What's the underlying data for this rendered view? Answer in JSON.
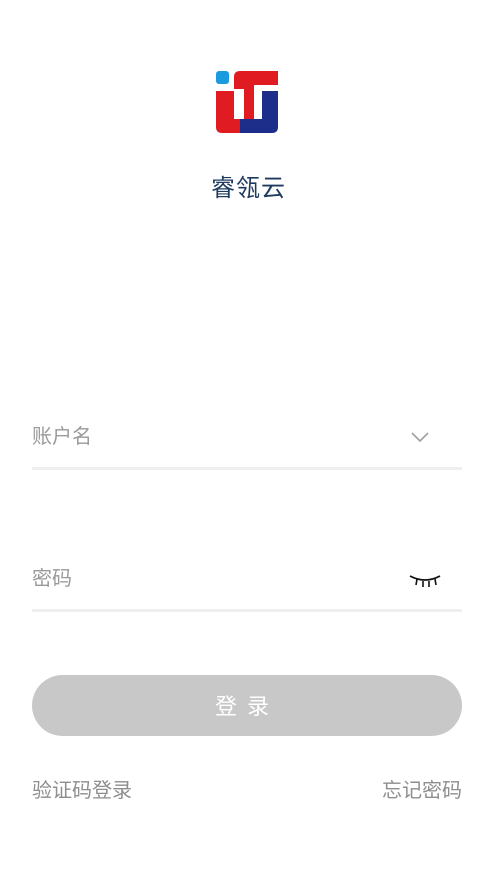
{
  "app": {
    "name": "睿瓴云"
  },
  "form": {
    "account_placeholder": "账户名",
    "password_placeholder": "密码",
    "login_label": "登录"
  },
  "links": {
    "sms_login": "验证码登录",
    "forgot_password": "忘记密码"
  },
  "icons": {
    "logo": "app-logo",
    "account_dropdown": "chevron-down-icon",
    "password_toggle": "eye-closed-icon"
  },
  "colors": {
    "brand_red": "#e01b22",
    "brand_blue": "#1c2e8a",
    "brand_cyan": "#1a9be0",
    "title_text": "#1f3a5f",
    "button_disabled": "#c8c8c8"
  }
}
